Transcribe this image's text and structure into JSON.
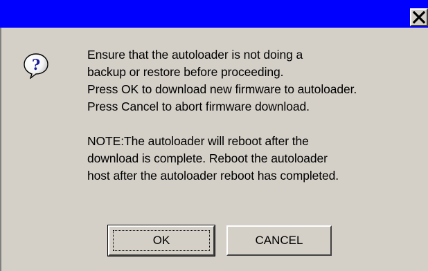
{
  "window": {
    "close_symbol": "✕",
    "title_bar_color": "#0000ff",
    "background_color": "#d4d0c8"
  },
  "icon": {
    "name": "question-icon",
    "glyph": "?"
  },
  "message": {
    "lines": [
      "Ensure that the autoloader is not doing a",
      "backup or restore before proceeding.",
      "Press OK to download new firmware to autoloader.",
      "Press Cancel to abort firmware download."
    ],
    "note_lines": [
      "NOTE:The autoloader will reboot after the",
      "download is complete. Reboot the autoloader",
      "host after the autoloader reboot has completed."
    ]
  },
  "buttons": {
    "ok_label": "OK",
    "cancel_label": "CANCEL"
  }
}
